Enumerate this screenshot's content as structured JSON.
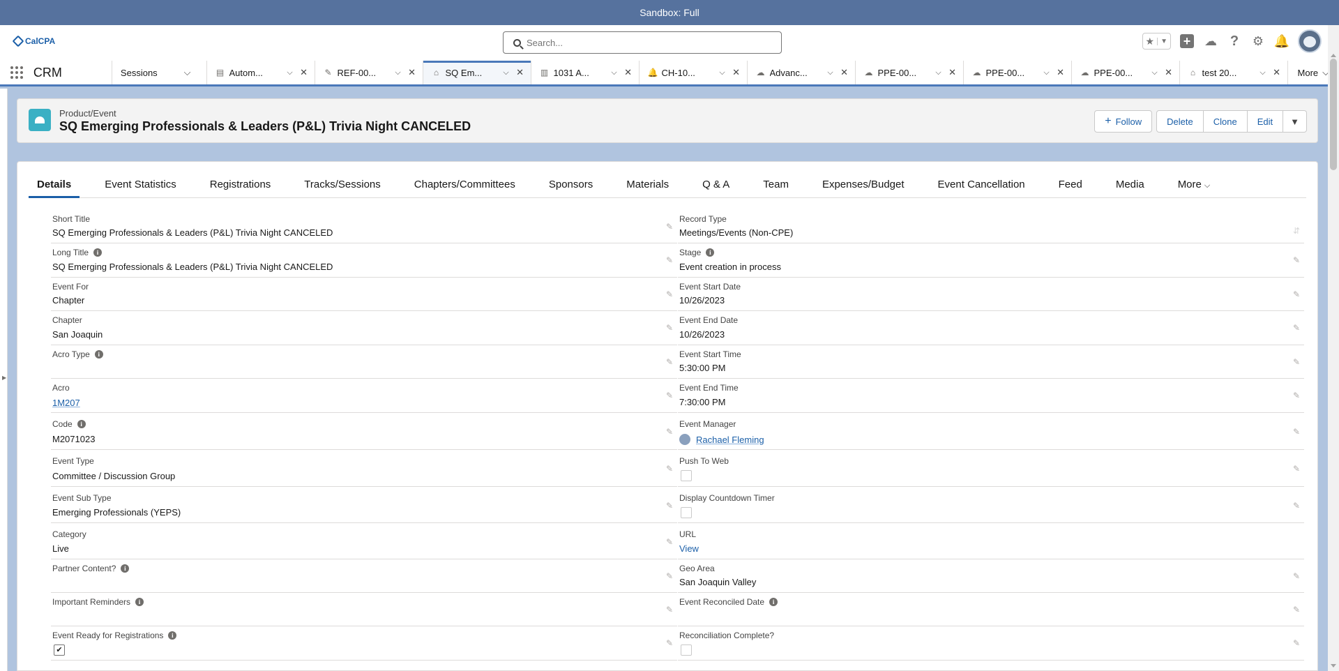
{
  "sandbox": {
    "label": "Sandbox: Full"
  },
  "header": {
    "logo_text": "CalCPA",
    "search_placeholder": "Search...",
    "icons": [
      "favorites-star-icon",
      "favorites-list-icon",
      "global-create-icon",
      "trailhead-icon",
      "help-icon",
      "setup-gear-icon",
      "notifications-bell-icon",
      "user-avatar"
    ]
  },
  "nav": {
    "app_name": "CRM",
    "selector_label": "Sessions",
    "tabs": [
      {
        "label": "Autom...",
        "icon": "report-icon",
        "active": false
      },
      {
        "label": "REF-00...",
        "icon": "case-icon",
        "active": false
      },
      {
        "label": "SQ Em...",
        "icon": "event-icon",
        "active": true
      },
      {
        "label": "1031 A...",
        "icon": "account-icon",
        "active": false
      },
      {
        "label": "CH-10...",
        "icon": "bell-icon",
        "active": false
      },
      {
        "label": "Advanc...",
        "icon": "cloud-icon",
        "active": false
      },
      {
        "label": "PPE-00...",
        "icon": "cloud-icon",
        "active": false
      },
      {
        "label": "PPE-00...",
        "icon": "cloud-icon",
        "active": false
      },
      {
        "label": "PPE-00...",
        "icon": "cloud-icon",
        "active": false
      },
      {
        "label": "test 20...",
        "icon": "event-icon",
        "active": false
      }
    ],
    "more_label": "More"
  },
  "record": {
    "object_label": "Product/Event",
    "title": "SQ Emerging Professionals & Leaders (P&L) Trivia Night CANCELED",
    "actions": {
      "follow": "Follow",
      "delete": "Delete",
      "clone": "Clone",
      "edit": "Edit"
    }
  },
  "record_tabs": [
    {
      "label": "Details",
      "active": true
    },
    {
      "label": "Event Statistics"
    },
    {
      "label": "Registrations"
    },
    {
      "label": "Tracks/Sessions"
    },
    {
      "label": "Chapters/Committees"
    },
    {
      "label": "Sponsors"
    },
    {
      "label": "Materials"
    },
    {
      "label": "Q & A"
    },
    {
      "label": "Team"
    },
    {
      "label": "Expenses/Budget"
    },
    {
      "label": "Event Cancellation"
    },
    {
      "label": "Feed"
    },
    {
      "label": "Media"
    },
    {
      "label": "More"
    }
  ],
  "fields_left": [
    {
      "label": "Short Title",
      "value": "SQ Emerging Professionals & Leaders (P&L) Trivia Night CANCELED",
      "info": false
    },
    {
      "label": "Long Title",
      "value": "SQ Emerging Professionals & Leaders (P&L) Trivia Night CANCELED",
      "info": true
    },
    {
      "label": "Event For",
      "value": "Chapter",
      "info": false
    },
    {
      "label": "Chapter",
      "value": "San Joaquin",
      "info": false
    },
    {
      "label": "Acro Type",
      "value": "",
      "info": true
    },
    {
      "label": "Acro",
      "value": "1M207",
      "info": false,
      "link": true
    },
    {
      "label": "Code",
      "value": "M2071023",
      "info": true
    },
    {
      "label": "Event Type",
      "value": "Committee / Discussion Group",
      "info": false
    },
    {
      "label": "Event Sub Type",
      "value": "Emerging Professionals (YEPS)",
      "info": false
    },
    {
      "label": "Category",
      "value": "Live",
      "info": false
    },
    {
      "label": "Partner Content?",
      "value": "",
      "info": true
    },
    {
      "label": "Important Reminders",
      "value": "",
      "info": true
    },
    {
      "label": "Event Ready for Registrations",
      "value": "",
      "info": true,
      "checkbox": true,
      "checked": true
    }
  ],
  "fields_right": [
    {
      "label": "Record Type",
      "value": "Meetings/Events (Non-CPE)",
      "info": false
    },
    {
      "label": "Stage",
      "value": "Event creation in process",
      "info": true
    },
    {
      "label": "Event Start Date",
      "value": "10/26/2023",
      "info": false
    },
    {
      "label": "Event End Date",
      "value": "10/26/2023",
      "info": false
    },
    {
      "label": "Event Start Time",
      "value": "5:30:00 PM",
      "info": false
    },
    {
      "label": "Event End Time",
      "value": "7:30:00 PM",
      "info": false
    },
    {
      "label": "Event Manager",
      "value": "Rachael Fleming",
      "info": false,
      "link": true
    },
    {
      "label": "Push To Web",
      "value": "",
      "info": false,
      "checkbox": true,
      "checked": false
    },
    {
      "label": "Display Countdown Timer",
      "value": "",
      "info": false,
      "checkbox": true,
      "checked": false
    },
    {
      "label": "URL",
      "value": "View",
      "info": false
    },
    {
      "label": "Geo Area",
      "value": "San Joaquin Valley",
      "info": false
    },
    {
      "label": "Event Reconciled Date",
      "value": "",
      "info": true
    },
    {
      "label": "Reconciliation Complete?",
      "value": "",
      "info": false,
      "checkbox": true,
      "checked": false
    }
  ],
  "colors": {
    "brand": "#1b5fa8",
    "sandbox_bar": "#56729e",
    "page_bg": "#b0c4df",
    "object_icon": "#3ab0c4"
  }
}
